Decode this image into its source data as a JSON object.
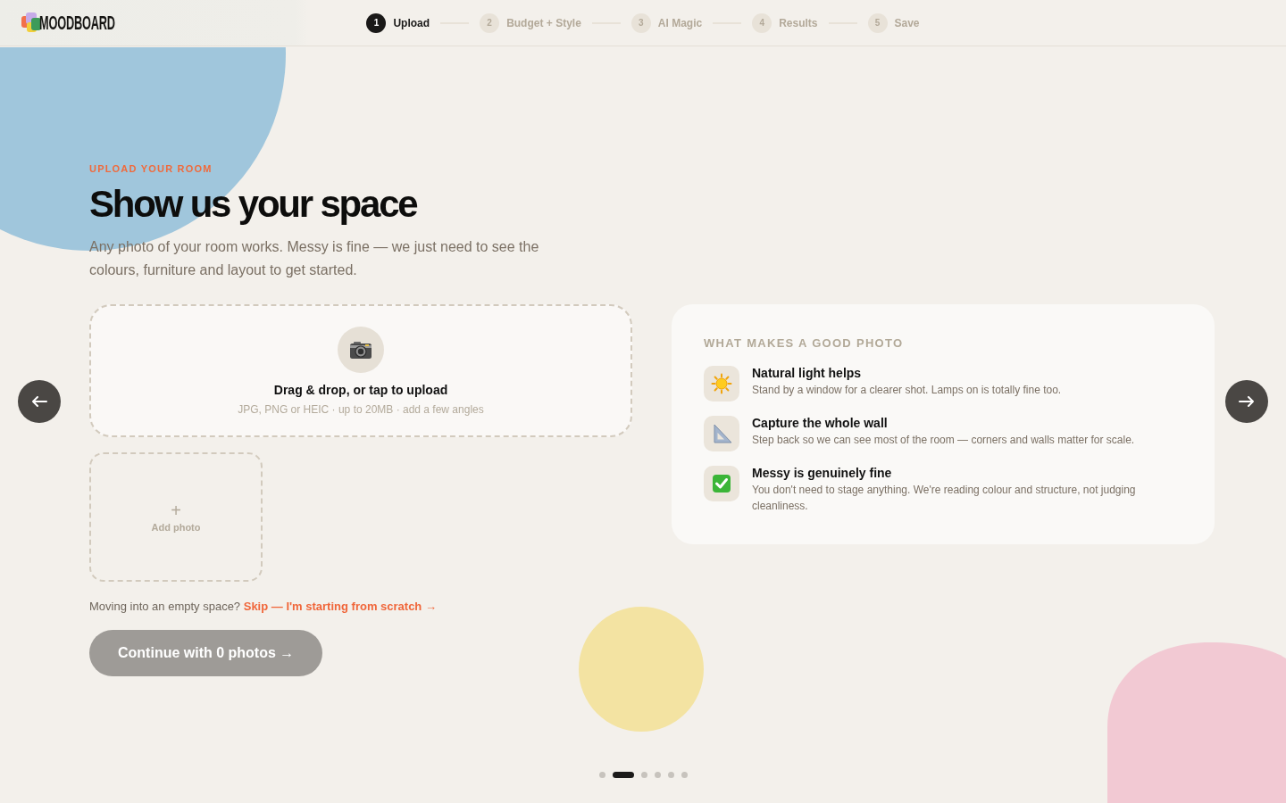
{
  "header": {
    "logo": "MOODBOARD",
    "steps": [
      {
        "number": "1",
        "label": "Upload",
        "selected": true
      },
      {
        "number": "2",
        "label": "Budget + Style",
        "selected": false
      },
      {
        "number": "3",
        "label": "AI Magic",
        "selected": false
      },
      {
        "number": "4",
        "label": "Results",
        "selected": false
      },
      {
        "number": "5",
        "label": "Save",
        "selected": false
      }
    ]
  },
  "intro": {
    "eyebrow": "UPLOAD YOUR ROOM",
    "title": "Show us your space",
    "description": "Any photo of your room works. Messy is fine — we just need to see the colours, furniture and layout to get started."
  },
  "upload": {
    "dropzone": {
      "title": "Drag & drop, or tap to upload",
      "hint": "JPG, PNG or HEIC · up to 20MB · add a few angles"
    },
    "add_tile": {
      "plus": "+",
      "label": "Add photo"
    },
    "skip": {
      "prompt": "Moving into an empty space?",
      "link": "Skip — I'm starting from scratch →"
    },
    "continue_button": {
      "label": "Continue with 0 photos →",
      "disabled": true
    }
  },
  "tips": {
    "heading": "WHAT MAKES A GOOD PHOTO",
    "items": [
      {
        "kind": "sun",
        "title": "Natural light helps",
        "description": "Stand by a window for a clearer shot. Lamps on is totally fine too."
      },
      {
        "kind": "ruler",
        "title": "Capture the whole wall",
        "description": "Step back so we can see most of the room — corners and walls matter for scale."
      },
      {
        "kind": "check",
        "title": "Messy is genuinely fine",
        "description": "You don't need to stage anything. We're reading colour and structure, not judging cleanliness."
      }
    ]
  },
  "pager": {
    "dots": [
      {
        "selected": false
      },
      {
        "selected": true
      },
      {
        "selected": false
      },
      {
        "selected": false
      },
      {
        "selected": false
      },
      {
        "selected": false
      }
    ]
  }
}
